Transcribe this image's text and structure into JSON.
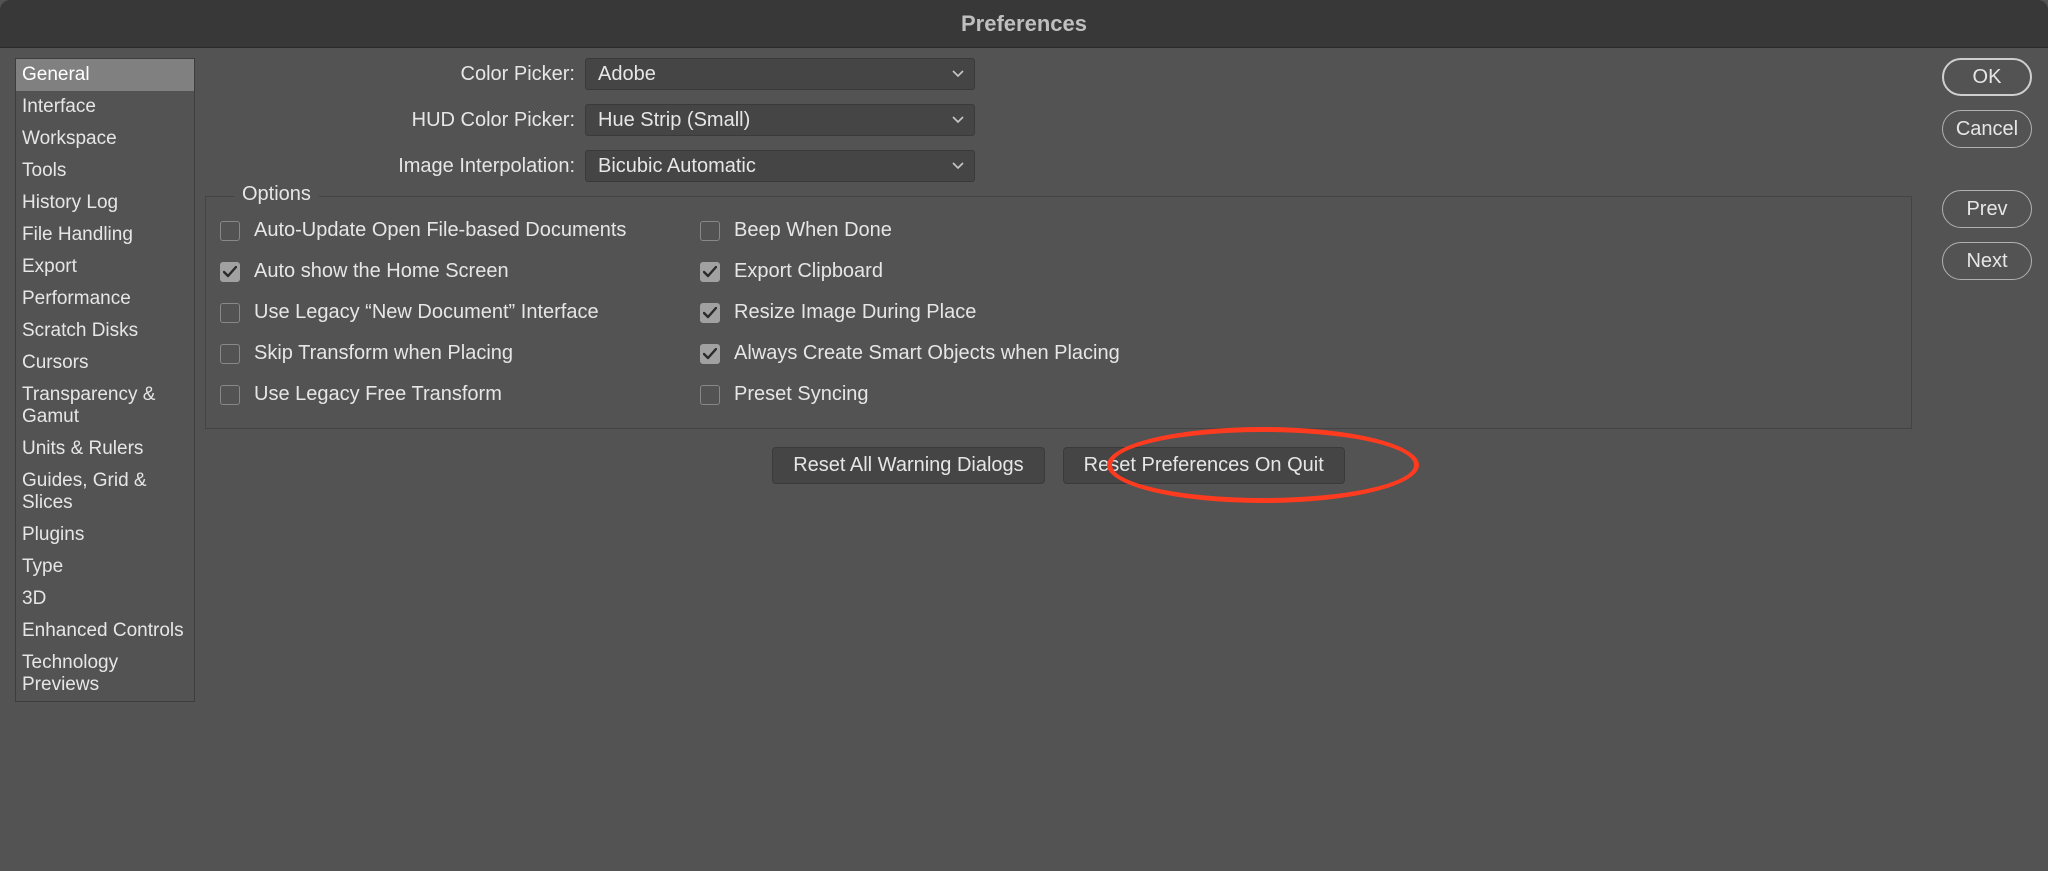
{
  "window": {
    "title": "Preferences"
  },
  "sidebar": {
    "items": [
      {
        "label": "General",
        "selected": true
      },
      {
        "label": "Interface"
      },
      {
        "label": "Workspace"
      },
      {
        "label": "Tools"
      },
      {
        "label": "History Log"
      },
      {
        "label": "File Handling"
      },
      {
        "label": "Export"
      },
      {
        "label": "Performance"
      },
      {
        "label": "Scratch Disks"
      },
      {
        "label": "Cursors"
      },
      {
        "label": "Transparency & Gamut"
      },
      {
        "label": "Units & Rulers"
      },
      {
        "label": "Guides, Grid & Slices"
      },
      {
        "label": "Plugins"
      },
      {
        "label": "Type"
      },
      {
        "label": "3D"
      },
      {
        "label": "Enhanced Controls"
      },
      {
        "label": "Technology Previews"
      }
    ]
  },
  "dropdowns": {
    "color_picker": {
      "label": "Color Picker:",
      "value": "Adobe"
    },
    "hud_color_picker": {
      "label": "HUD Color Picker:",
      "value": "Hue Strip (Small)"
    },
    "image_interpolation": {
      "label": "Image Interpolation:",
      "value": "Bicubic Automatic"
    }
  },
  "options": {
    "legend": "Options",
    "left": [
      {
        "label": "Auto-Update Open File-based Documents",
        "checked": false
      },
      {
        "label": "Auto show the Home Screen",
        "checked": true
      },
      {
        "label": "Use Legacy “New Document” Interface",
        "checked": false
      },
      {
        "label": "Skip Transform when Placing",
        "checked": false
      },
      {
        "label": "Use Legacy Free Transform",
        "checked": false
      }
    ],
    "right": [
      {
        "label": "Beep When Done",
        "checked": false
      },
      {
        "label": "Export Clipboard",
        "checked": true
      },
      {
        "label": "Resize Image During Place",
        "checked": true
      },
      {
        "label": "Always Create Smart Objects when Placing",
        "checked": true
      },
      {
        "label": "Preset Syncing",
        "checked": false
      }
    ]
  },
  "reset_buttons": {
    "warning": "Reset All Warning Dialogs",
    "quit": "Reset Preferences On Quit"
  },
  "action_buttons": {
    "ok": "OK",
    "cancel": "Cancel",
    "prev": "Prev",
    "next": "Next"
  }
}
